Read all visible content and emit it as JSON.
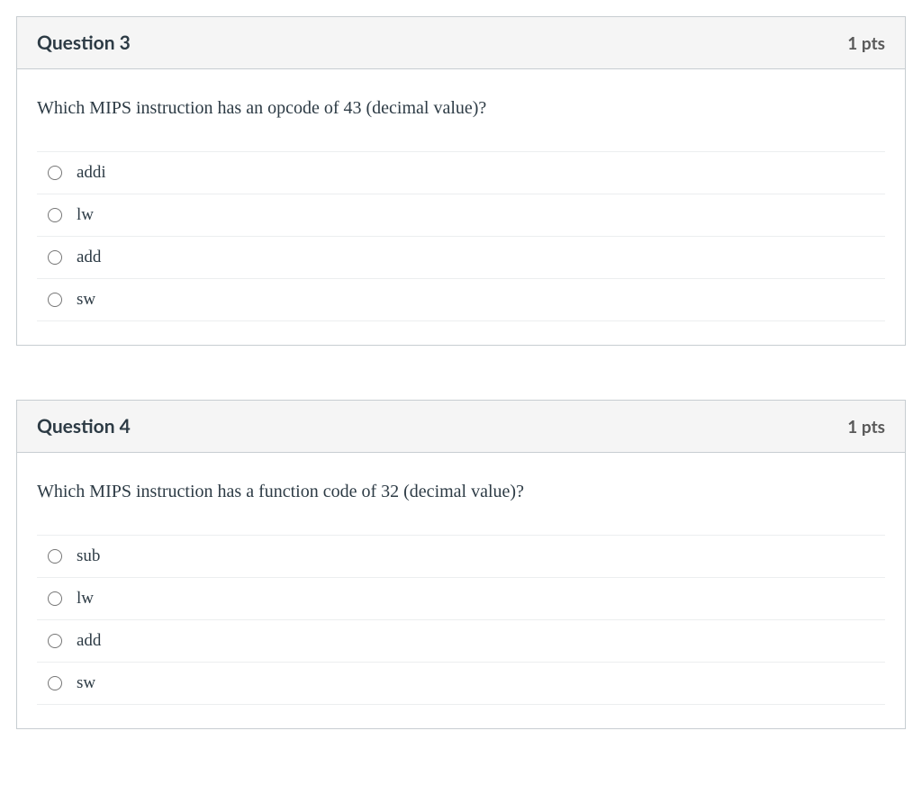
{
  "questions": [
    {
      "title": "Question 3",
      "points": "1 pts",
      "prompt": "Which MIPS instruction has an opcode of 43 (decimal value)?",
      "options": [
        "addi",
        "lw",
        "add",
        "sw"
      ]
    },
    {
      "title": "Question 4",
      "points": "1 pts",
      "prompt": "Which MIPS instruction has a function code of 32 (decimal value)?",
      "options": [
        "sub",
        "lw",
        "add",
        "sw"
      ]
    }
  ]
}
